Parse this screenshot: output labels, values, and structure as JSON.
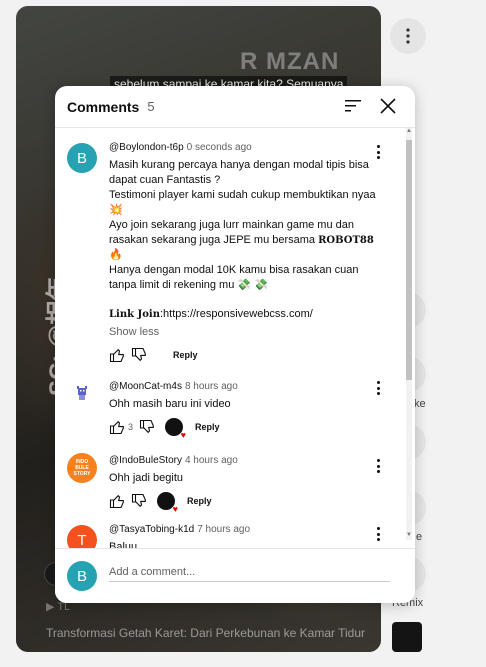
{
  "video": {
    "caption": "sebelum sampai ke kamar kita? Semuanya",
    "watermark": "R   MZAN",
    "vertical_text": "SC: @相年",
    "music": "TL",
    "title": "Transformasi Getah Karet: Dari Perkebunan ke Kamar Tidur"
  },
  "rail": {
    "labels": [
      "ke",
      "e",
      "Remix"
    ]
  },
  "panel": {
    "title": "Comments",
    "count": "5",
    "sort_icon": "sort-icon",
    "close_icon": "close-icon"
  },
  "comments": [
    {
      "avatar_letter": "B",
      "avatar_color": "#26a2b3",
      "author": "@Boylondon-t6p",
      "time": "0 seconds ago",
      "text_parts": {
        "p1": "Masih kurang percaya hanya dengan modal tipis bisa dapat cuan Fantastis ?\nTestimoni player kami sudah cukup membuktikan nyaa 💥\nAyo join sekarang juga lurr mainkan game mu dan rasakan sekarang juga JEPE mu bersama ",
        "brand": "ROBOT88",
        "p2": " 🔥\nHanya dengan modal 10K kamu bisa rasakan cuan tanpa limit di rekening mu 💸 💸",
        "link_label": "Link Join",
        "link_value": ":https://responsivewebcss.com/"
      },
      "show_less": "Show less",
      "reply": "Reply"
    },
    {
      "avatar_color": "#ffffff",
      "author": "@MoonCat-m4s",
      "time": "8 hours ago",
      "text": "Ohh masih baru ini video",
      "likes": "3",
      "reply": "Reply"
    },
    {
      "avatar_color": "#f5821f",
      "avatar_text": "INDO BULE STORY",
      "author": "@IndoBuleStory",
      "time": "4 hours ago",
      "text": "Ohh jadi begitu",
      "reply": "Reply"
    },
    {
      "avatar_letter": "T",
      "avatar_color": "#f4511e",
      "author": "@TasyaTobing-k1d",
      "time": "7 hours ago",
      "text": "Baluu..."
    }
  ],
  "add_comment": {
    "avatar_letter": "B",
    "avatar_color": "#26a2b3",
    "placeholder": "Add a comment..."
  }
}
